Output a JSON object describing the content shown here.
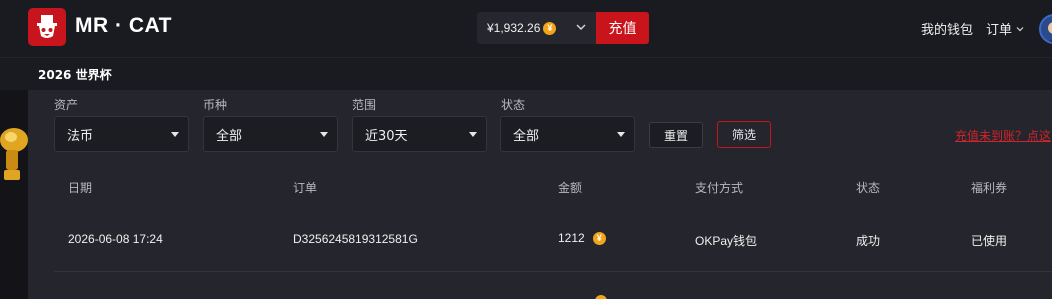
{
  "header": {
    "brand": "MR · CAT",
    "balance": "¥1,932.26",
    "coin_symbol": "¥",
    "topup_label": "充值",
    "wallet_label": "我的钱包",
    "orders_label": "订单",
    "accent_color": "#c9141c",
    "coin_color": "#f4a417"
  },
  "subnav": {
    "event": "2026 世界杯"
  },
  "filters": {
    "asset": {
      "label": "资产",
      "value": "法币"
    },
    "currency": {
      "label": "币种",
      "value": "全部"
    },
    "range": {
      "label": "范围",
      "value": "近30天"
    },
    "status": {
      "label": "状态",
      "value": "全部"
    },
    "reset_label": "重置",
    "filter_label": "筛选",
    "missing_link": "充值未到账？点这"
  },
  "table": {
    "columns": [
      "日期",
      "订单",
      "金额",
      "支付方式",
      "状态",
      "福利券"
    ],
    "rows": [
      {
        "date": "2026-06-08 17:24",
        "order": "D3256245819312581G",
        "amount": "1212",
        "method": "OKPay钱包",
        "status": "成功",
        "coupon": "已使用"
      }
    ]
  },
  "icons": {
    "logo": "cat-top-hat-logo-icon",
    "coin": "yuan-coin-icon",
    "dropdown": "chevron-down-icon",
    "avatar": "user-avatar",
    "side": "trophy-icon"
  }
}
